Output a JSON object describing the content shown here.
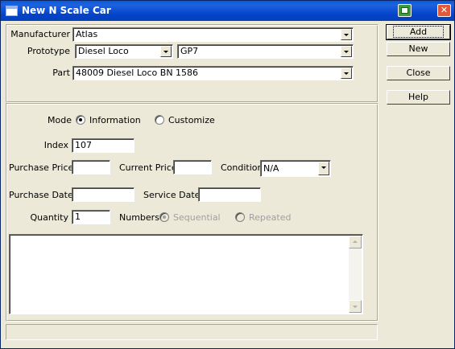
{
  "window": {
    "title": "New N Scale Car"
  },
  "identity": {
    "manufacturer_label": "Manufacturer",
    "manufacturer_value": "Atlas",
    "prototype_label": "Prototype",
    "prototype_type_value": "Diesel Loco",
    "prototype_model_value": "GP7",
    "part_label": "Part",
    "part_value": "48009 Diesel Loco BN 1586"
  },
  "buttons": {
    "add": "Add",
    "new": "New",
    "close": "Close",
    "help": "Help"
  },
  "details": {
    "mode_label": "Mode",
    "mode_options": [
      "Information",
      "Customize"
    ],
    "mode_selected": "Information",
    "index_label": "Index",
    "index_value": "107",
    "purchase_price_label": "Purchase Price",
    "purchase_price_value": "",
    "current_price_label": "Current Price",
    "current_price_value": "",
    "condition_label": "Condition",
    "condition_value": "N/A",
    "purchase_date_label": "Purchase Date",
    "purchase_date_value": "",
    "service_date_label": "Service Date",
    "service_date_value": "",
    "quantity_label": "Quantity",
    "quantity_value": "1",
    "numbers_label": "Numbers",
    "numbers_options": [
      "Sequential",
      "Repeated"
    ],
    "numbers_selected": "Sequential",
    "notes_value": ""
  },
  "status": {
    "text": ""
  },
  "colors": {
    "titlebar": "#0443c8",
    "face": "#ece9d8"
  }
}
